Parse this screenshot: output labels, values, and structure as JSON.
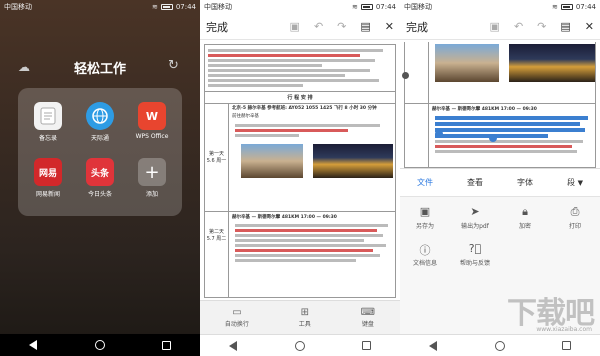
{
  "status": {
    "carrier": "中国移动",
    "time": "07:44"
  },
  "home": {
    "folder_title": "轻松工作",
    "apps": [
      {
        "label": "备忘录",
        "icon": "notes-icon",
        "color": "#f2f2f2",
        "text_color": "#888"
      },
      {
        "label": "天际通",
        "icon": "globe-icon",
        "color": "#2e9ce4",
        "text_color": "#fff"
      },
      {
        "label": "WPS Office",
        "icon": "wps-icon",
        "color": "#e8452f",
        "text_color": "#fff"
      },
      {
        "label": "网易新闻",
        "icon": "netease-icon",
        "color": "#d2282a",
        "text_color": "#fff"
      },
      {
        "label": "今日头条",
        "icon": "toutiao-icon",
        "color": "#e0343a",
        "text_color": "#fff"
      },
      {
        "label": "添加",
        "icon": "plus-icon",
        "color": "rgba(255,255,255,0.25)",
        "text_color": "#fff"
      }
    ],
    "app_glyphs": {
      "wps": "W",
      "netease": "网易",
      "toutiao": "头条",
      "plus": "+"
    }
  },
  "editor": {
    "done_label": "完成",
    "doc_header": "行 程 安 排",
    "day1_label": "第一天",
    "day1_date": "5.6 周一",
    "day1_title": "北京-5 赫尔辛基   参考航班: AY052   1055 1425   飞行 8 小时 30 分钟",
    "day1_title2": "前往赫尔辛基",
    "day2_label": "第二天",
    "day2_date": "5.7 周二",
    "day2_title": "赫尔辛基 — 斯德哥尔摩   481KM   17:00 — 09:30",
    "tools": [
      "自动换行",
      "工具",
      "键盘"
    ]
  },
  "menu": {
    "done_label": "完成",
    "selected_heading": "赫尔辛基 — 斯德哥尔摩   481KM   17:00 — 09:30",
    "tabs": [
      "文件",
      "查看",
      "字体",
      "段"
    ],
    "items": [
      {
        "label": "另存为",
        "icon": "save-as-icon"
      },
      {
        "label": "输出为pdf",
        "icon": "export-pdf-icon"
      },
      {
        "label": "加密",
        "icon": "lock-icon"
      },
      {
        "label": "打印",
        "icon": "print-icon"
      },
      {
        "label": "文档信息",
        "icon": "info-icon"
      },
      {
        "label": "帮助与反馈",
        "icon": "help-icon"
      }
    ],
    "watermark": "下载吧",
    "watermark_url": "www.xiazaiba.com"
  }
}
